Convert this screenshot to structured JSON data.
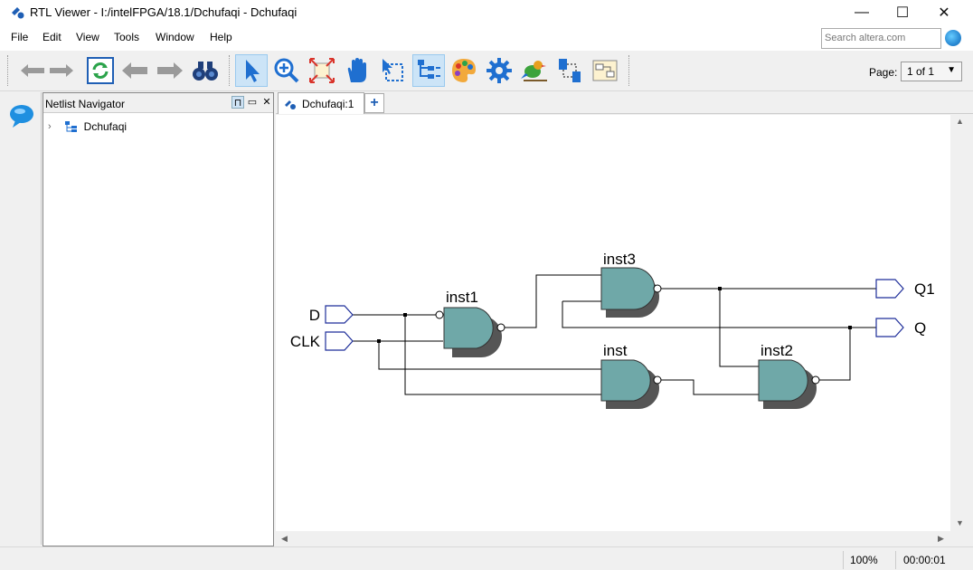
{
  "window": {
    "title": "RTL Viewer - I:/intelFPGA/18.1/Dchufaqi - Dchufaqi",
    "controls": {
      "minimize": "—",
      "maximize": "☐",
      "close": "✕"
    }
  },
  "menu": {
    "items": [
      "File",
      "Edit",
      "View",
      "Tools",
      "Window",
      "Help"
    ]
  },
  "search": {
    "placeholder": "Search altera.com"
  },
  "toolbar": {
    "icons": [
      "back-icon",
      "forward-icon",
      "refresh-icon",
      "previous-page-icon",
      "next-page-icon",
      "find-binoculars-icon",
      "select-pointer-icon",
      "zoom-icon",
      "fit-in-window-icon",
      "hand-pan-icon",
      "area-select-icon",
      "hierarchy-icon",
      "color-palette-icon",
      "settings-gear-icon",
      "bird-icon",
      "netlist-icon",
      "export-icon"
    ],
    "page_label": "Page:",
    "page_value": "1 of 1"
  },
  "navigator": {
    "title": "Netlist Navigator",
    "tree": [
      {
        "label": "Dchufaqi"
      }
    ]
  },
  "tabs": [
    {
      "label": "Dchufaqi:1"
    }
  ],
  "tab_add": "+",
  "schematic": {
    "inputs": [
      "D",
      "CLK"
    ],
    "outputs": [
      "Q1",
      "Q"
    ],
    "instances": [
      "inst1",
      "inst3",
      "inst",
      "inst2"
    ],
    "gate_color": "#6fa8a8"
  },
  "status": {
    "zoom": "100%",
    "time": "00:00:01"
  }
}
